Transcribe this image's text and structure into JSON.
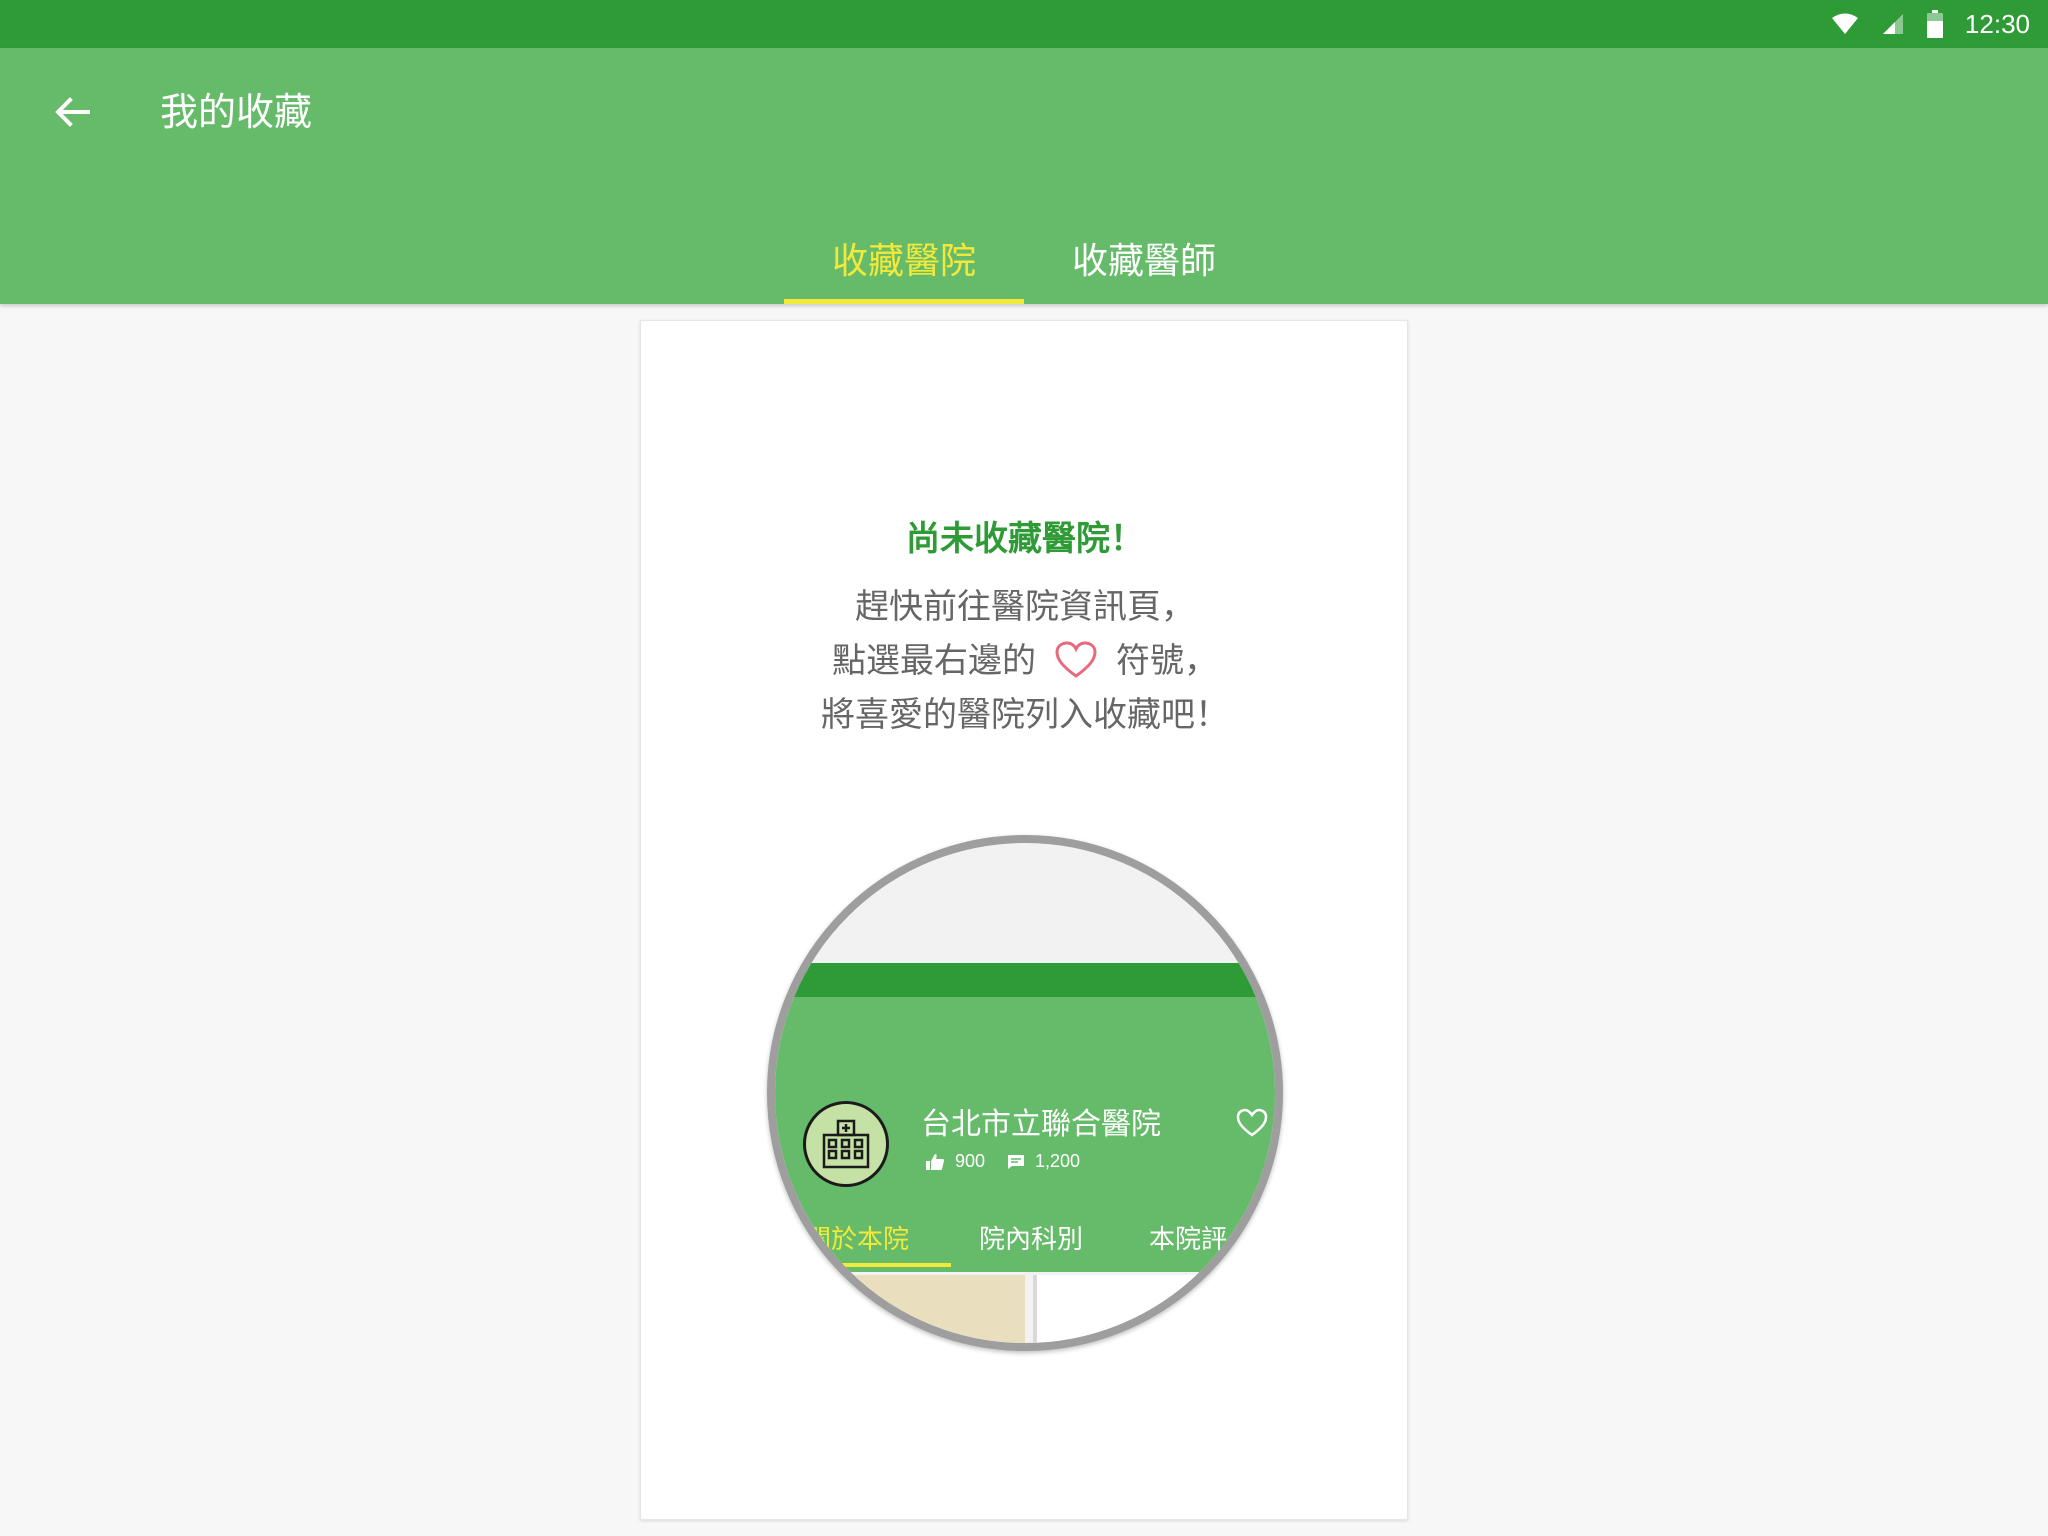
{
  "status_bar": {
    "time": "12:30",
    "icons": [
      "wifi-icon",
      "signal-icon",
      "battery-icon"
    ],
    "color": "#2f9b37"
  },
  "app_bar": {
    "title": "我的收藏",
    "back_icon": "arrow-back-icon",
    "color": "#66bb6a"
  },
  "tabs": [
    {
      "label": "收藏醫院",
      "selected": true
    },
    {
      "label": "收藏醫師",
      "selected": false
    }
  ],
  "empty_state": {
    "title": "尚未收藏醫院！",
    "line1": "趕快前往醫院資訊頁，",
    "line2_before": "點選最右邊的",
    "line2_after": "符號，",
    "line3": "將喜愛的醫院列入收藏吧！",
    "heart_icon": "heart-outline-icon",
    "heart_color": "#e86a7e"
  },
  "illustration": {
    "hospital_name": "台北市立聯合醫院",
    "likes": "900",
    "comments": "1,200",
    "avatar_icon": "hospital-building-icon",
    "tabs": [
      {
        "label": "關於本院",
        "selected": true
      },
      {
        "label": "院內科別",
        "selected": false
      },
      {
        "label": "本院評",
        "selected": false
      }
    ]
  },
  "colors": {
    "accent": "#f3e93a",
    "primary": "#66bb6a",
    "primary_dark": "#2f9b37"
  }
}
